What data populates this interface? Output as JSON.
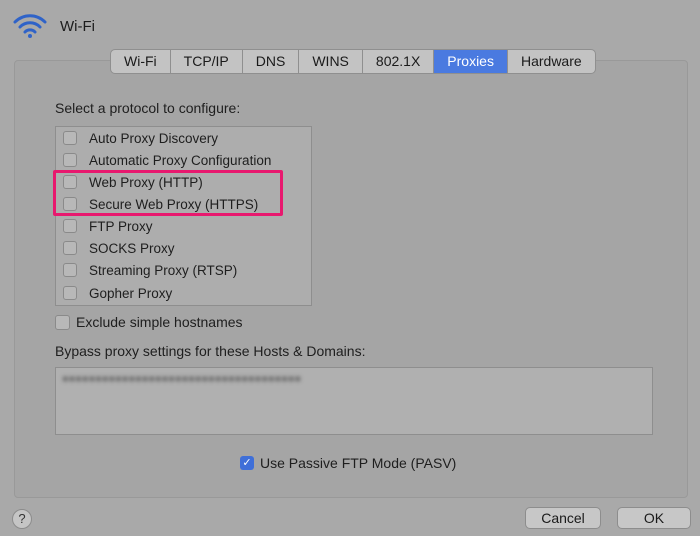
{
  "window": {
    "title": "Wi-Fi",
    "icon": "wifi-icon"
  },
  "tabs": [
    {
      "label": "Wi-Fi",
      "active": false
    },
    {
      "label": "TCP/IP",
      "active": false
    },
    {
      "label": "DNS",
      "active": false
    },
    {
      "label": "WINS",
      "active": false
    },
    {
      "label": "802.1X",
      "active": false
    },
    {
      "label": "Proxies",
      "active": true
    },
    {
      "label": "Hardware",
      "active": false
    }
  ],
  "protocols": {
    "heading": "Select a protocol to configure:",
    "items": [
      {
        "label": "Auto Proxy Discovery",
        "checked": false
      },
      {
        "label": "Automatic Proxy Configuration",
        "checked": false
      },
      {
        "label": "Web Proxy (HTTP)",
        "checked": false
      },
      {
        "label": "Secure Web Proxy (HTTPS)",
        "checked": false
      },
      {
        "label": "FTP Proxy",
        "checked": false
      },
      {
        "label": "SOCKS Proxy",
        "checked": false
      },
      {
        "label": "Streaming Proxy (RTSP)",
        "checked": false
      },
      {
        "label": "Gopher Proxy",
        "checked": false
      }
    ]
  },
  "exclude_simple": {
    "label": "Exclude simple hostnames",
    "checked": false
  },
  "bypass": {
    "label": "Bypass proxy settings for these Hosts & Domains:"
  },
  "pasv": {
    "label": "Use Passive FTP Mode (PASV)",
    "checked": true
  },
  "footer": {
    "help_label": "?",
    "cancel_label": "Cancel",
    "ok_label": "OK"
  },
  "colors": {
    "highlight": "#e8186e",
    "accent": "#4a7ae0"
  }
}
